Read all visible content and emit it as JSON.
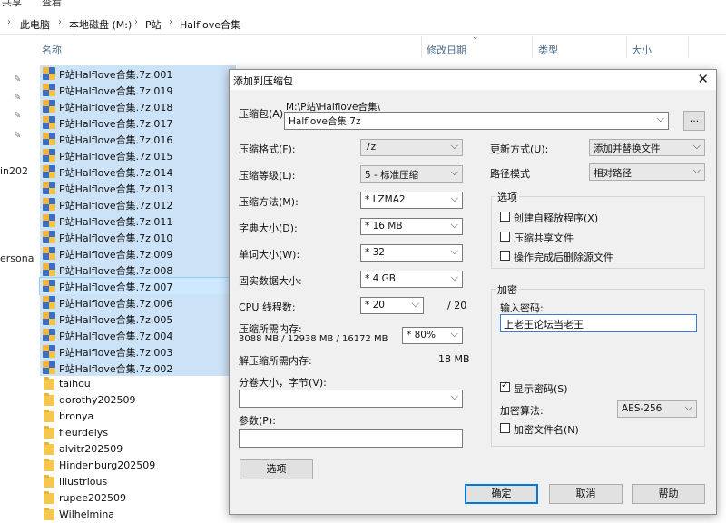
{
  "explorer": {
    "ribbon": [
      "共享",
      "查看"
    ],
    "breadcrumb": [
      "此电脑",
      "本地磁盘 (M:)",
      "P站",
      "Halflove合集"
    ],
    "columns": {
      "name": "名称",
      "modified": "修改日期",
      "type": "类型",
      "size": "大小"
    },
    "nav_fragments": [
      "in202",
      "ersona"
    ],
    "files": [
      {
        "name": "P站Halflove合集.7z.001",
        "kind": "zip",
        "selected": true
      },
      {
        "name": "P站Halflove合集.7z.019",
        "kind": "zip",
        "selected": true
      },
      {
        "name": "P站Halflove合集.7z.018",
        "kind": "zip",
        "selected": true
      },
      {
        "name": "P站Halflove合集.7z.017",
        "kind": "zip",
        "selected": true
      },
      {
        "name": "P站Halflove合集.7z.016",
        "kind": "zip",
        "selected": true
      },
      {
        "name": "P站Halflove合集.7z.015",
        "kind": "zip",
        "selected": true
      },
      {
        "name": "P站Halflove合集.7z.014",
        "kind": "zip",
        "selected": true
      },
      {
        "name": "P站Halflove合集.7z.013",
        "kind": "zip",
        "selected": true
      },
      {
        "name": "P站Halflove合集.7z.012",
        "kind": "zip",
        "selected": true
      },
      {
        "name": "P站Halflove合集.7z.011",
        "kind": "zip",
        "selected": true
      },
      {
        "name": "P站Halflove合集.7z.010",
        "kind": "zip",
        "selected": true
      },
      {
        "name": "P站Halflove合集.7z.009",
        "kind": "zip",
        "selected": true
      },
      {
        "name": "P站Halflove合集.7z.008",
        "kind": "zip",
        "selected": true
      },
      {
        "name": "P站Halflove合集.7z.007",
        "kind": "zip",
        "selected": true,
        "focus": true
      },
      {
        "name": "P站Halflove合集.7z.006",
        "kind": "zip",
        "selected": true
      },
      {
        "name": "P站Halflove合集.7z.005",
        "kind": "zip",
        "selected": true
      },
      {
        "name": "P站Halflove合集.7z.004",
        "kind": "zip",
        "selected": true
      },
      {
        "name": "P站Halflove合集.7z.003",
        "kind": "zip",
        "selected": true
      },
      {
        "name": "P站Halflove合集.7z.002",
        "kind": "zip",
        "selected": true
      },
      {
        "name": "taihou",
        "kind": "folder"
      },
      {
        "name": "dorothy202509",
        "kind": "folder"
      },
      {
        "name": "bronya",
        "kind": "folder"
      },
      {
        "name": "fleurdelys",
        "kind": "folder"
      },
      {
        "name": "alvitr202509",
        "kind": "folder"
      },
      {
        "name": "Hindenburg202509",
        "kind": "folder"
      },
      {
        "name": "illustrious",
        "kind": "folder"
      },
      {
        "name": "rupee202509",
        "kind": "folder"
      },
      {
        "name": "Wilhelmina",
        "kind": "folder"
      }
    ]
  },
  "dialog": {
    "title": "添加到压缩包",
    "archive_label": "压缩包(A)",
    "archive_path": "M:\\P站\\Halflove合集\\",
    "archive_name": "Halflove合集.7z",
    "browse_label": "...",
    "format_label": "压缩格式(F):",
    "format_value": "7z",
    "level_label": "压缩等级(L):",
    "level_value": "5 - 标准压缩",
    "method_label": "压缩方法(M):",
    "method_value": "* LZMA2",
    "dict_label": "字典大小(D):",
    "dict_value": "* 16 MB",
    "word_label": "单词大小(W):",
    "word_value": "* 32",
    "solid_label": "固实数据大小:",
    "solid_value": "* 4 GB",
    "cpu_label": "CPU 线程数:",
    "cpu_value": "* 20",
    "cpu_total": "/ 20",
    "mem_label": "压缩所需内存:",
    "mem_detail": "3088 MB / 12938 MB / 16172 MB",
    "mem_percent": "* 80%",
    "decomp_label": "解压缩所需内存:",
    "decomp_value": "18 MB",
    "volume_label": "分卷大小，字节(V):",
    "params_label": "参数(P):",
    "options_button": "选项",
    "update_label": "更新方式(U):",
    "update_value": "添加并替换文件",
    "path_label": "路径模式",
    "path_value": "相对路径",
    "options_group": "选项",
    "opt_sfx": "创建自释放程序(X)",
    "opt_shared": "压缩共享文件",
    "opt_delete": "操作完成后删除源文件",
    "encrypt_group": "加密",
    "password_label": "输入密码:",
    "password_value": "上老王论坛当老王",
    "show_password": "显示密码(S)",
    "enc_method_label": "加密算法:",
    "enc_method_value": "AES-256",
    "enc_names": "加密文件名(N)",
    "ok": "确定",
    "cancel": "取消",
    "help": "帮助"
  }
}
